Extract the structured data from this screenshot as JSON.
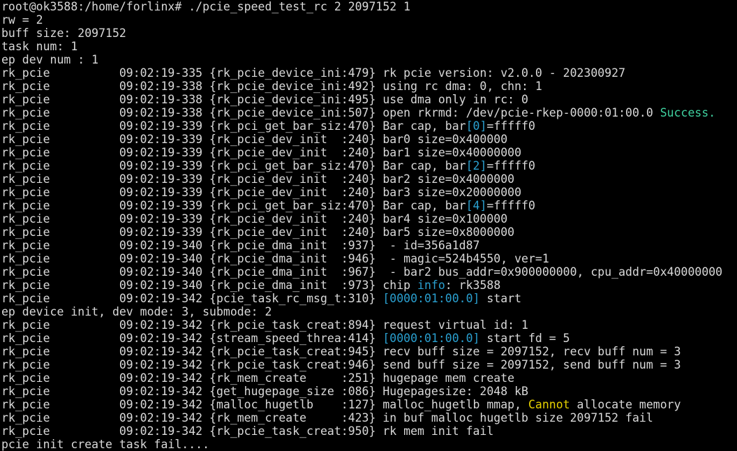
{
  "terminal": {
    "colors": {
      "foreground": "#d9d9d9",
      "background": "#000000",
      "success": "#3fd2a0",
      "bracket": "#2aa0d0",
      "warning": "#e5d000"
    },
    "lines": [
      [
        {
          "t": "root@ok3588:/home/forlinx# ./pcie_speed_test_rc 2 2097152 1"
        }
      ],
      [
        {
          "t": "rw = 2"
        }
      ],
      [
        {
          "t": "buff size: 2097152"
        }
      ],
      [
        {
          "t": "task num: 1"
        }
      ],
      [
        {
          "t": "ep dev num : 1"
        }
      ],
      [
        {
          "t": "rk_pcie          09:02:19-335 {rk_pcie_device_ini:479} rk pcie version: v2.0.0 - 202300927"
        }
      ],
      [
        {
          "t": "rk_pcie          09:02:19-338 {rk_pcie_device_ini:492} using rc dma: 0, chn: 1"
        }
      ],
      [
        {
          "t": "rk_pcie          09:02:19-338 {rk_pcie_device_ini:495} use dma only in rc: 0"
        }
      ],
      [
        {
          "t": "rk_pcie          09:02:19-338 {rk_pcie_device_ini:507} open rkrmd: /dev/pcie-rkep-0000:01:00.0 "
        },
        {
          "t": "Success.",
          "c": "success"
        }
      ],
      [
        {
          "t": "rk_pcie          09:02:19-339 {rk_pci_get_bar_siz:470} Bar cap, bar"
        },
        {
          "t": "[0]",
          "c": "bracket"
        },
        {
          "t": "=fffff0"
        }
      ],
      [
        {
          "t": "rk_pcie          09:02:19-339 {rk_pcie_dev_init  :240} bar0 size=0x400000"
        }
      ],
      [
        {
          "t": "rk_pcie          09:02:19-339 {rk_pcie_dev_init  :240} bar1 size=0x40000000"
        }
      ],
      [
        {
          "t": "rk_pcie          09:02:19-339 {rk_pci_get_bar_siz:470} Bar cap, bar"
        },
        {
          "t": "[2]",
          "c": "bracket"
        },
        {
          "t": "=fffff0"
        }
      ],
      [
        {
          "t": "rk_pcie          09:02:19-339 {rk_pcie_dev_init  :240} bar2 size=0x4000000"
        }
      ],
      [
        {
          "t": "rk_pcie          09:02:19-339 {rk_pcie_dev_init  :240} bar3 size=0x20000000"
        }
      ],
      [
        {
          "t": "rk_pcie          09:02:19-339 {rk_pci_get_bar_siz:470} Bar cap, bar"
        },
        {
          "t": "[4]",
          "c": "bracket"
        },
        {
          "t": "=fffff0"
        }
      ],
      [
        {
          "t": "rk_pcie          09:02:19-339 {rk_pcie_dev_init  :240} bar4 size=0x100000"
        }
      ],
      [
        {
          "t": "rk_pcie          09:02:19-339 {rk_pcie_dev_init  :240} bar5 size=0x8000000"
        }
      ],
      [
        {
          "t": "rk_pcie          09:02:19-340 {rk_pcie_dma_init  :937}  - id=356a1d87"
        }
      ],
      [
        {
          "t": "rk_pcie          09:02:19-340 {rk_pcie_dma_init  :946}  - magic=524b4550, ver=1"
        }
      ],
      [
        {
          "t": "rk_pcie          09:02:19-340 {rk_pcie_dma_init  :967}  - bar2 bus_addr=0x900000000, cpu_addr=0x40000000"
        }
      ],
      [
        {
          "t": "rk_pcie          09:02:19-340 {rk_pcie_dma_init  :973} chip "
        },
        {
          "t": "info",
          "c": "bracket"
        },
        {
          "t": ": rk3588"
        }
      ],
      [
        {
          "t": "rk_pcie          09:02:19-342 {pcie_task_rc_msg_t:310} "
        },
        {
          "t": "[0000:01:00.0]",
          "c": "bracket"
        },
        {
          "t": " start"
        }
      ],
      [
        {
          "t": "ep device init, dev mode: 3, submode: 2"
        }
      ],
      [
        {
          "t": "rk_pcie          09:02:19-342 {rk_pcie_task_creat:894} request virtual id: 1"
        }
      ],
      [
        {
          "t": "rk_pcie          09:02:19-342 {stream_speed_threa:414} "
        },
        {
          "t": "[0000:01:00.0]",
          "c": "bracket"
        },
        {
          "t": " start fd = 5"
        }
      ],
      [
        {
          "t": "rk_pcie          09:02:19-342 {rk_pcie_task_creat:945} recv buff size = 2097152, recv buff num = 3"
        }
      ],
      [
        {
          "t": "rk_pcie          09:02:19-342 {rk_pcie_task_creat:946} send buff size = 2097152, send buff num = 3"
        }
      ],
      [
        {
          "t": "rk_pcie          09:02:19-342 {rk_mem_create     :251} hugepage mem create"
        }
      ],
      [
        {
          "t": "rk_pcie          09:02:19-342 {get_hugepage_size :086} Hugepagesize: 2048 kB"
        }
      ],
      [
        {
          "t": "rk_pcie          09:02:19-342 {malloc_hugetlb    :127} malloc_hugetlb mmap, "
        },
        {
          "t": "Cannot",
          "c": "warning"
        },
        {
          "t": " allocate memory"
        }
      ],
      [
        {
          "t": "rk_pcie          09:02:19-342 {rk_mem_create     :423} in buf malloc hugetlb size 2097152 fail"
        }
      ],
      [
        {
          "t": "rk_pcie          09:02:19-342 {rk_pcie_task_creat:950} rk mem init fail"
        }
      ],
      [
        {
          "t": "pcie init create task fail...."
        }
      ]
    ]
  }
}
